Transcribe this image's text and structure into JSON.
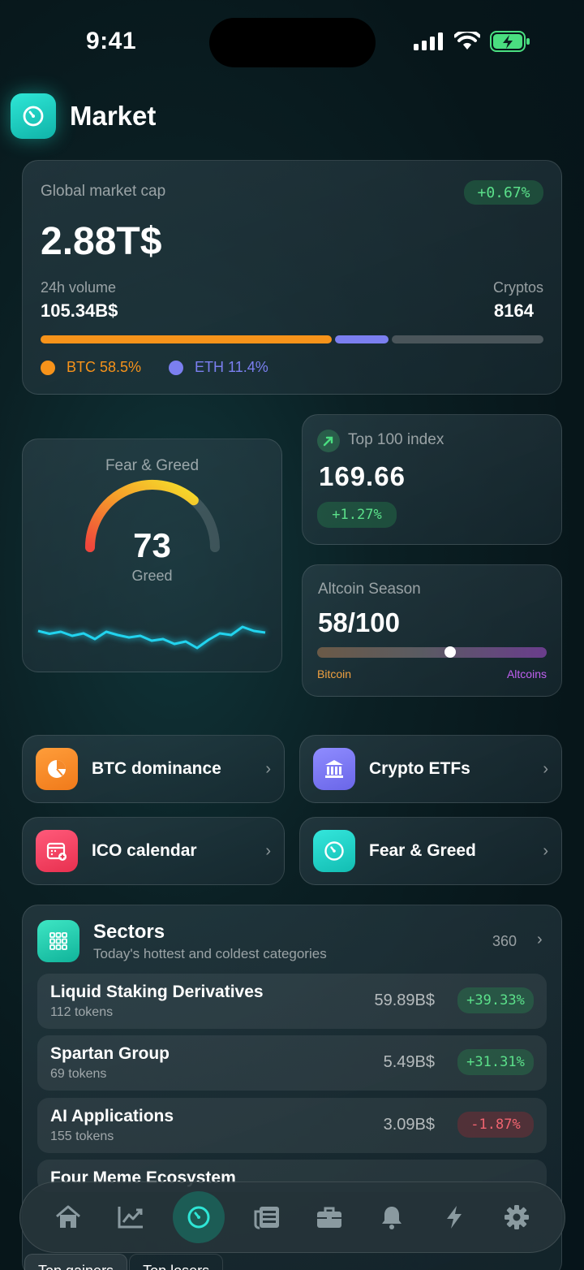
{
  "status_bar": {
    "time": "9:41"
  },
  "header": {
    "title": "Market"
  },
  "market_cap": {
    "label": "Global market cap",
    "change": "+0.67%",
    "value": "2.88T$",
    "volume_label": "24h volume",
    "volume_value": "105.34B$",
    "cryptos_label": "Cryptos",
    "cryptos_value": "8164",
    "btc_legend": "BTC 58.5%",
    "eth_legend": "ETH 11.4%",
    "btc_share": 58.5,
    "eth_share": 11.4,
    "colors": {
      "btc": "#f7931a",
      "eth": "#7b7ff0",
      "rest": "#4a555a"
    }
  },
  "fear_greed": {
    "title": "Fear & Greed",
    "value": "73",
    "label": "Greed",
    "gauge_fraction": 0.73,
    "history": [
      0.62,
      0.55,
      0.6,
      0.5,
      0.56,
      0.42,
      0.6,
      0.52,
      0.46,
      0.5,
      0.38,
      0.42,
      0.3,
      0.36,
      0.2,
      0.4,
      0.56,
      0.52,
      0.72,
      0.62,
      0.58
    ]
  },
  "top100": {
    "title": "Top 100 index",
    "value": "169.66",
    "change": "+1.27%"
  },
  "altcoin_season": {
    "title": "Altcoin Season",
    "value": "58/100",
    "level": 0.58,
    "left_label": "Bitcoin",
    "right_label": "Altcoins"
  },
  "quick_links": [
    {
      "label": "BTC dominance",
      "icon": "pie-chart-icon",
      "color": "#f5892a"
    },
    {
      "label": "Crypto ETFs",
      "icon": "bank-icon",
      "color": "#7b78f0"
    },
    {
      "label": "ICO calendar",
      "icon": "calendar-icon",
      "color": "#f04565"
    },
    {
      "label": "Fear & Greed",
      "icon": "gauge-icon",
      "color": "#1fd6cc"
    }
  ],
  "sectors": {
    "title": "Sectors",
    "subtitle": "Today's hottest and coldest categories",
    "count": "360",
    "rows": [
      {
        "name": "Liquid Staking Derivatives",
        "tokens": "112 tokens",
        "value": "59.89B$",
        "change": "+39.33%",
        "positive": true
      },
      {
        "name": "Spartan Group",
        "tokens": "69 tokens",
        "value": "5.49B$",
        "change": "+31.31%",
        "positive": true
      },
      {
        "name": "AI Applications",
        "tokens": "155 tokens",
        "value": "3.09B$",
        "change": "-1.87%",
        "positive": false
      },
      {
        "name": "Four Meme Ecosystem",
        "tokens": "",
        "value": "",
        "change": "",
        "positive": false
      }
    ]
  },
  "bottom_tabs": [
    "Top gainers",
    "Top losers"
  ],
  "tabbar": [
    "home-icon",
    "chart-icon",
    "gauge-icon",
    "news-icon",
    "briefcase-icon",
    "bell-icon",
    "bolt-icon",
    "gear-icon"
  ]
}
